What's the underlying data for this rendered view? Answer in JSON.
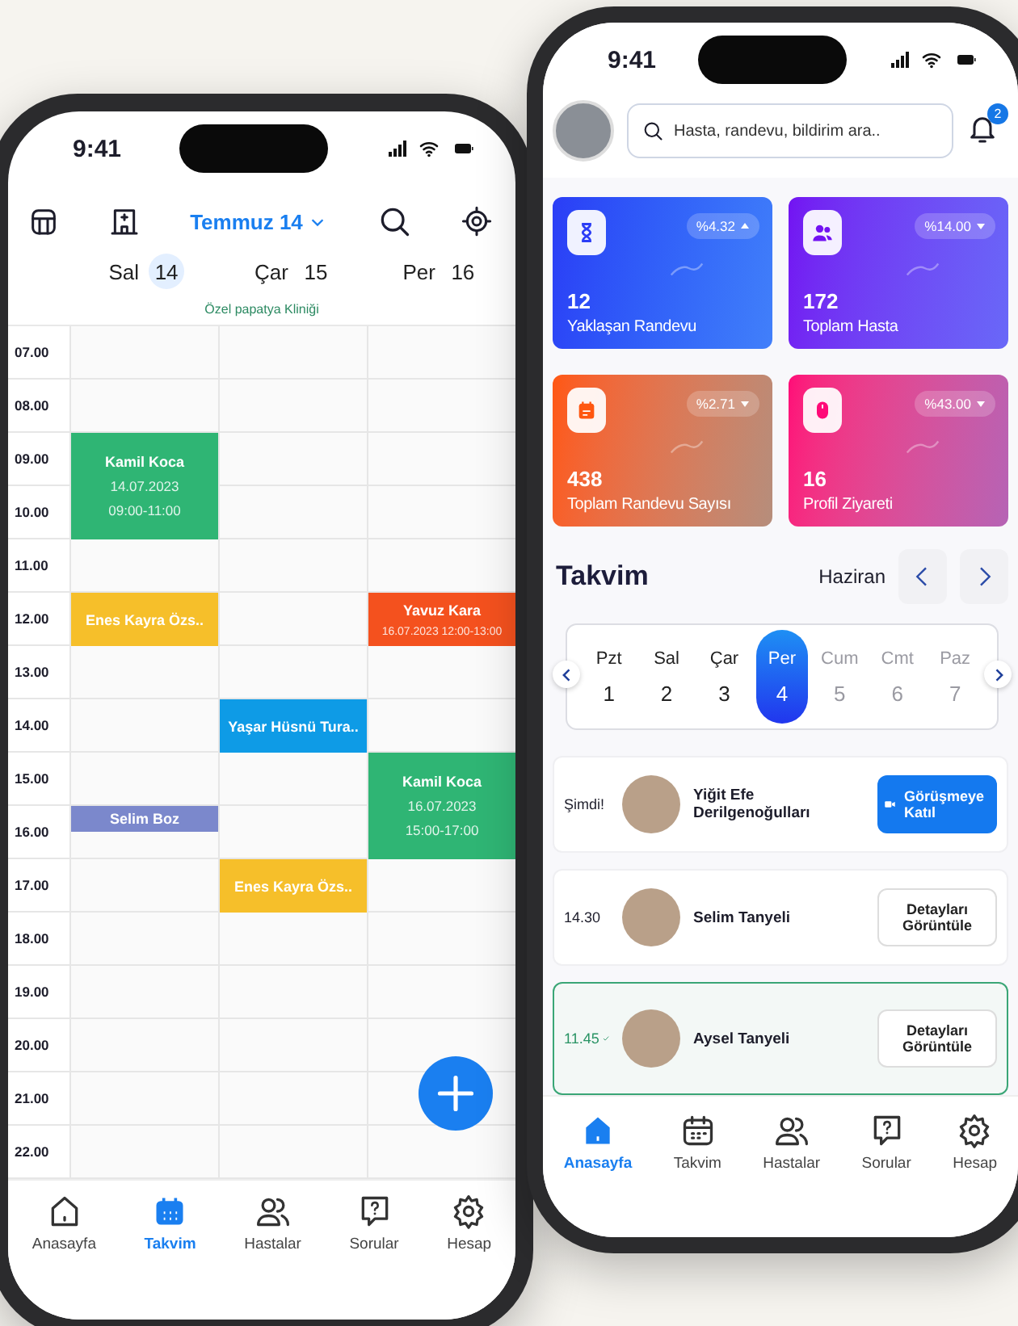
{
  "left_phone": {
    "status_time": "9:41",
    "month": "Temmuz 14",
    "days": [
      {
        "name": "Sal",
        "date": "14",
        "selected": true
      },
      {
        "name": "Çar",
        "date": "15",
        "selected": false
      },
      {
        "name": "Per",
        "date": "16",
        "selected": false
      }
    ],
    "clinic": "Özel papatya Kliniği",
    "hours": [
      "07.00",
      "08.00",
      "09.00",
      "10.00",
      "11.00",
      "12.00",
      "13.00",
      "14.00",
      "15.00",
      "16.00",
      "17.00",
      "18.00",
      "19.00",
      "20.00",
      "21.00",
      "22.00"
    ],
    "columns": [
      {
        "slots": [
          {
            "kind": "empty"
          },
          {
            "kind": "empty"
          },
          {
            "kind": "event",
            "title": "Kamil Koca",
            "details": [
              "14.07.2023",
              "09:00-11:00"
            ],
            "color": "#2fb574"
          },
          {
            "kind": "continued"
          },
          {
            "kind": "empty"
          },
          {
            "kind": "event",
            "title": "Enes Kayra Özs..",
            "color": "#f6bf2a"
          },
          {
            "kind": "empty"
          },
          {
            "kind": "empty"
          },
          {
            "kind": "empty"
          },
          {
            "kind": "short",
            "title": "Selim Boz",
            "color": "#7b88cc"
          },
          {
            "kind": "empty"
          },
          {
            "kind": "empty"
          },
          {
            "kind": "empty"
          },
          {
            "kind": "empty"
          },
          {
            "kind": "empty"
          },
          {
            "kind": "empty"
          }
        ]
      },
      {
        "slots": [
          {
            "kind": "empty"
          },
          {
            "kind": "empty"
          },
          {
            "kind": "empty"
          },
          {
            "kind": "empty"
          },
          {
            "kind": "empty"
          },
          {
            "kind": "empty"
          },
          {
            "kind": "empty"
          },
          {
            "kind": "event",
            "title": "Yaşar Hüsnü Tura..",
            "color": "#0e9be6"
          },
          {
            "kind": "empty"
          },
          {
            "kind": "empty"
          },
          {
            "kind": "event",
            "title": "Enes Kayra Özs..",
            "color": "#f6bf2a"
          },
          {
            "kind": "empty"
          },
          {
            "kind": "empty"
          },
          {
            "kind": "empty"
          },
          {
            "kind": "empty"
          },
          {
            "kind": "empty"
          }
        ]
      },
      {
        "slots": [
          {
            "kind": "empty"
          },
          {
            "kind": "empty"
          },
          {
            "kind": "empty"
          },
          {
            "kind": "empty"
          },
          {
            "kind": "empty"
          },
          {
            "kind": "event",
            "title": "Yavuz Kara",
            "details": [
              "16.07.2023 12:00-13:00"
            ],
            "color": "#f4511e"
          },
          {
            "kind": "empty"
          },
          {
            "kind": "empty"
          },
          {
            "kind": "event",
            "title": "Kamil Koca",
            "details": [
              "16.07.2023",
              "15:00-17:00"
            ],
            "color": "#2fb574"
          },
          {
            "kind": "continued"
          },
          {
            "kind": "empty"
          },
          {
            "kind": "empty"
          },
          {
            "kind": "empty"
          },
          {
            "kind": "empty"
          },
          {
            "kind": "empty"
          },
          {
            "kind": "empty"
          }
        ]
      }
    ],
    "nav": [
      {
        "label": "Anasayfa",
        "kind": "home",
        "selected": false
      },
      {
        "label": "Takvim",
        "kind": "calendar",
        "selected": true
      },
      {
        "label": "Hastalar",
        "kind": "people",
        "selected": false
      },
      {
        "label": "Sorular",
        "kind": "question",
        "selected": false
      },
      {
        "label": "Hesap",
        "kind": "gear",
        "selected": false
      }
    ]
  },
  "right_phone": {
    "status_time": "9:41",
    "search": {
      "placeholder": "Hasta, randevu, bildirim ara.."
    },
    "notifications": "2",
    "stats": [
      {
        "value": "12",
        "label": "Yaklaşan Randevu",
        "change": "%4.32",
        "rising": true,
        "kind": "hourglass",
        "color": "#2b3df6"
      },
      {
        "value": "172",
        "label": "Toplam Hasta",
        "change": "%14.00",
        "rising": false,
        "kind": "people",
        "color": "#7312f2"
      },
      {
        "value": "438",
        "label": "Toplam Randevu Sayısı",
        "change": "%2.71",
        "rising": false,
        "kind": "calendar",
        "color": "#ff5710"
      },
      {
        "value": "16",
        "label": "Profil Ziyareti",
        "change": "%43.00",
        "rising": false,
        "kind": "mouse",
        "color": "#ff0a78"
      }
    ],
    "calendar": {
      "title": "Takvim",
      "month": "Haziran",
      "days": [
        {
          "name": "Pzt",
          "date": "1",
          "selected": false,
          "muted": false
        },
        {
          "name": "Sal",
          "date": "2",
          "selected": false,
          "muted": false
        },
        {
          "name": "Çar",
          "date": "3",
          "selected": false,
          "muted": false
        },
        {
          "name": "Per",
          "date": "4",
          "selected": true,
          "muted": false
        },
        {
          "name": "Cum",
          "date": "5",
          "selected": false,
          "muted": true
        },
        {
          "name": "Cmt",
          "date": "6",
          "selected": false,
          "muted": true
        },
        {
          "name": "Paz",
          "date": "7",
          "selected": false,
          "muted": true
        }
      ]
    },
    "appointments": [
      {
        "time": "Şimdi!",
        "name": "Yiğit Efe Derilgenoğulları",
        "action": "Görüşmeye Katıl",
        "kind": "join",
        "done": false
      },
      {
        "time": "14.30",
        "name": "Selim Tanyeli",
        "action": "Detayları Görüntüle",
        "kind": "details",
        "done": false
      },
      {
        "time": "11.45",
        "name": "Aysel Tanyeli",
        "action": "Detayları Görüntüle",
        "kind": "details",
        "done": true
      }
    ],
    "nav": [
      {
        "label": "Anasayfa",
        "kind": "home",
        "selected": true
      },
      {
        "label": "Takvim",
        "kind": "calendar",
        "selected": false
      },
      {
        "label": "Hastalar",
        "kind": "people",
        "selected": false
      },
      {
        "label": "Sorular",
        "kind": "question",
        "selected": false
      },
      {
        "label": "Hesap",
        "kind": "gear",
        "selected": false
      }
    ]
  }
}
